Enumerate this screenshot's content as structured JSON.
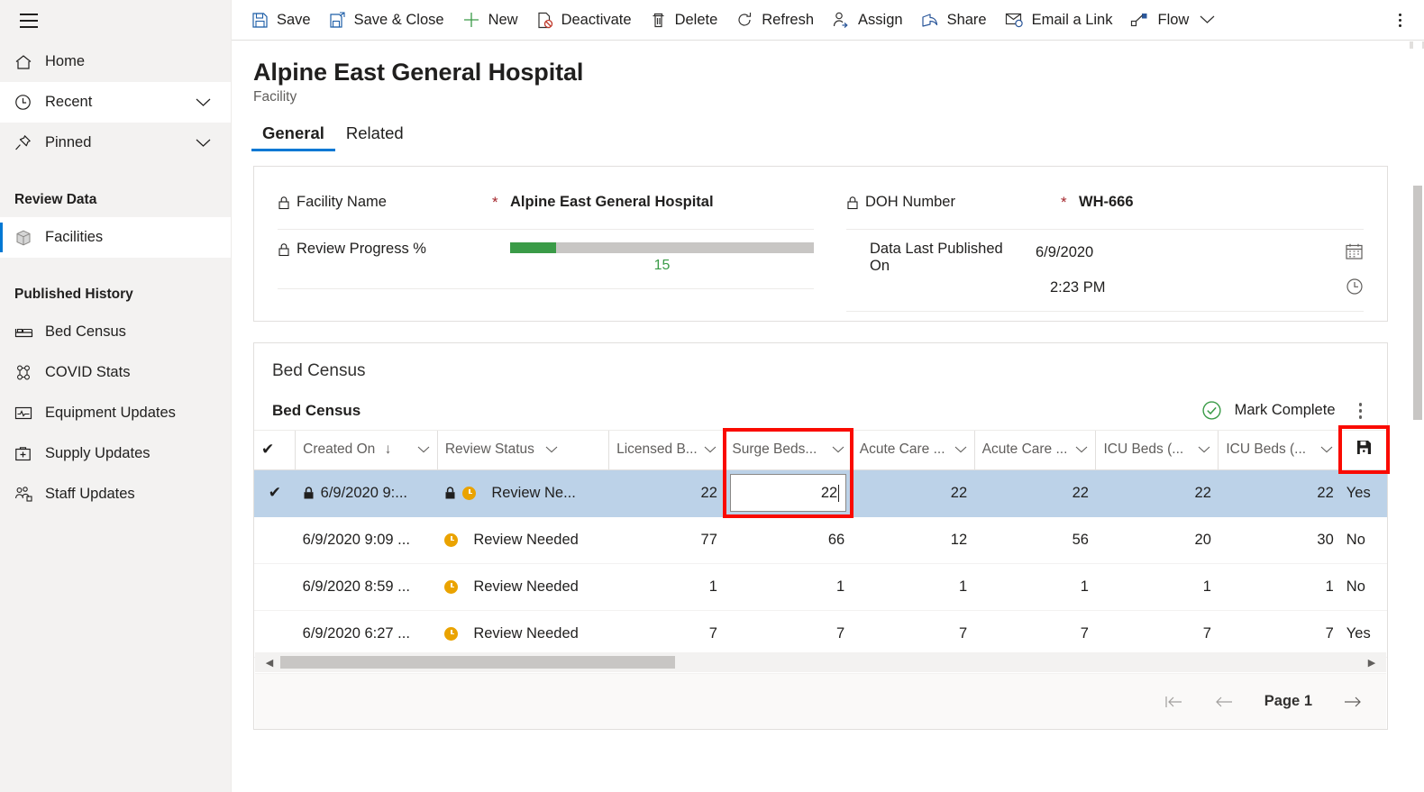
{
  "sidebar": {
    "menu_icon": "hamburger-icon",
    "items": [
      {
        "label": "Home",
        "icon": "home-icon",
        "chevron": false,
        "state": "default"
      },
      {
        "label": "Recent",
        "icon": "clock-icon",
        "chevron": true,
        "state": "white"
      },
      {
        "label": "Pinned",
        "icon": "pin-icon",
        "chevron": true,
        "state": "default"
      }
    ],
    "groups": [
      {
        "title": "Review Data",
        "items": [
          {
            "label": "Facilities",
            "icon": "cube-icon",
            "active": true
          }
        ]
      },
      {
        "title": "Published History",
        "items": [
          {
            "label": "Bed Census",
            "icon": "bed-icon",
            "active": false
          },
          {
            "label": "COVID Stats",
            "icon": "virus-icon",
            "active": false
          },
          {
            "label": "Equipment Updates",
            "icon": "monitor-icon",
            "active": false
          },
          {
            "label": "Supply Updates",
            "icon": "medkit-icon",
            "active": false
          },
          {
            "label": "Staff Updates",
            "icon": "people-icon",
            "active": false
          }
        ]
      }
    ]
  },
  "commandbar": {
    "items": [
      {
        "label": "Save",
        "icon": "save-icon"
      },
      {
        "label": "Save & Close",
        "icon": "save-close-icon"
      },
      {
        "label": "New",
        "icon": "plus-icon"
      },
      {
        "label": "Deactivate",
        "icon": "deactivate-icon"
      },
      {
        "label": "Delete",
        "icon": "trash-icon"
      },
      {
        "label": "Refresh",
        "icon": "refresh-icon"
      },
      {
        "label": "Assign",
        "icon": "assign-person-icon"
      },
      {
        "label": "Share",
        "icon": "share-icon"
      },
      {
        "label": "Email a Link",
        "icon": "email-icon"
      },
      {
        "label": "Flow",
        "icon": "flow-icon",
        "chevron": true
      }
    ],
    "overflow_icon": "more-vertical-icon"
  },
  "header": {
    "title": "Alpine East General Hospital",
    "subtitle": "Facility",
    "tabs": [
      {
        "label": "General",
        "active": true
      },
      {
        "label": "Related",
        "active": false
      }
    ]
  },
  "form": {
    "left": [
      {
        "label": "Facility Name",
        "locked": true,
        "required": true,
        "value": "Alpine East General Hospital",
        "type": "text"
      },
      {
        "label": "Review Progress %",
        "locked": true,
        "required": false,
        "value": "15",
        "type": "progress",
        "percent": 15,
        "bar_color": "#3a9b47",
        "track_color": "#c8c6c4"
      }
    ],
    "right": [
      {
        "label": "DOH Number",
        "locked": true,
        "required": true,
        "value": "WH-666",
        "type": "text"
      },
      {
        "label": "Data Last Published On",
        "locked": false,
        "required": false,
        "date": "6/9/2020",
        "time": "2:23 PM",
        "type": "datetime",
        "date_icon": "calendar-icon",
        "time_icon": "clock-icon"
      }
    ]
  },
  "grid": {
    "section_title": "Bed Census",
    "subgrid_title": "Bed Census",
    "mark_complete_label": "Mark Complete",
    "mark_complete_icon": "check-circle-icon",
    "mark_complete_color": "#3a9b47",
    "overflow_icon": "more-vertical-icon",
    "save_cell_icon": "save-icon",
    "columns": [
      {
        "label": "",
        "type": "check",
        "icon": "checkmark-icon"
      },
      {
        "label": "Created On",
        "sort": "↓",
        "menu": true
      },
      {
        "label": "Review Status",
        "menu": true
      },
      {
        "label": "Licensed B...",
        "menu": true,
        "align": "right"
      },
      {
        "label": "Surge Beds...",
        "menu": true,
        "align": "right",
        "highlighted": true
      },
      {
        "label": "Acute Care ...",
        "menu": true,
        "align": "right"
      },
      {
        "label": "Acute Care ...",
        "menu": true,
        "align": "right"
      },
      {
        "label": "ICU Beds (...",
        "menu": true,
        "align": "right"
      },
      {
        "label": "ICU Beds (...",
        "menu": true,
        "align": "right"
      },
      {
        "label": "",
        "type": "saveicon"
      }
    ],
    "rows": [
      {
        "selected": true,
        "checked": true,
        "created_on": "6/9/2020 9:...",
        "created_on_locked": true,
        "review_status": "Review Ne...",
        "review_status_locked": true,
        "review_status_icon": "pending-clock-icon",
        "licensed_beds": "22",
        "surge_beds": "22",
        "surge_beds_editing": true,
        "acute_care_1": "22",
        "acute_care_2": "22",
        "icu_beds_1": "22",
        "icu_beds_2": "22",
        "last": "Yes"
      },
      {
        "selected": false,
        "checked": false,
        "created_on": "6/9/2020 9:09 ...",
        "created_on_locked": false,
        "review_status": "Review Needed",
        "review_status_locked": false,
        "review_status_icon": "pending-clock-icon",
        "licensed_beds": "77",
        "surge_beds": "66",
        "surge_beds_editing": false,
        "acute_care_1": "12",
        "acute_care_2": "56",
        "icu_beds_1": "20",
        "icu_beds_2": "30",
        "last": "No"
      },
      {
        "selected": false,
        "checked": false,
        "created_on": "6/9/2020 8:59 ...",
        "created_on_locked": false,
        "review_status": "Review Needed",
        "review_status_locked": false,
        "review_status_icon": "pending-clock-icon",
        "licensed_beds": "1",
        "surge_beds": "1",
        "surge_beds_editing": false,
        "acute_care_1": "1",
        "acute_care_2": "1",
        "icu_beds_1": "1",
        "icu_beds_2": "1",
        "last": "No"
      },
      {
        "selected": false,
        "checked": false,
        "created_on": "6/9/2020 6:27 ...",
        "created_on_locked": false,
        "review_status": "Review Needed",
        "review_status_locked": false,
        "review_status_icon": "pending-clock-icon",
        "licensed_beds": "7",
        "surge_beds": "7",
        "surge_beds_editing": false,
        "acute_care_1": "7",
        "acute_care_2": "7",
        "icu_beds_1": "7",
        "icu_beds_2": "7",
        "last": "Yes"
      }
    ],
    "pager": {
      "first_icon": "page-first-icon",
      "prev_icon": "page-prev-icon",
      "label": "Page 1",
      "next_icon": "page-next-icon"
    }
  },
  "annotations": {
    "highlight_color": "#fa0a00",
    "boxes": [
      {
        "name": "surge-beds-column-highlight"
      },
      {
        "name": "save-row-icon-highlight"
      }
    ]
  }
}
